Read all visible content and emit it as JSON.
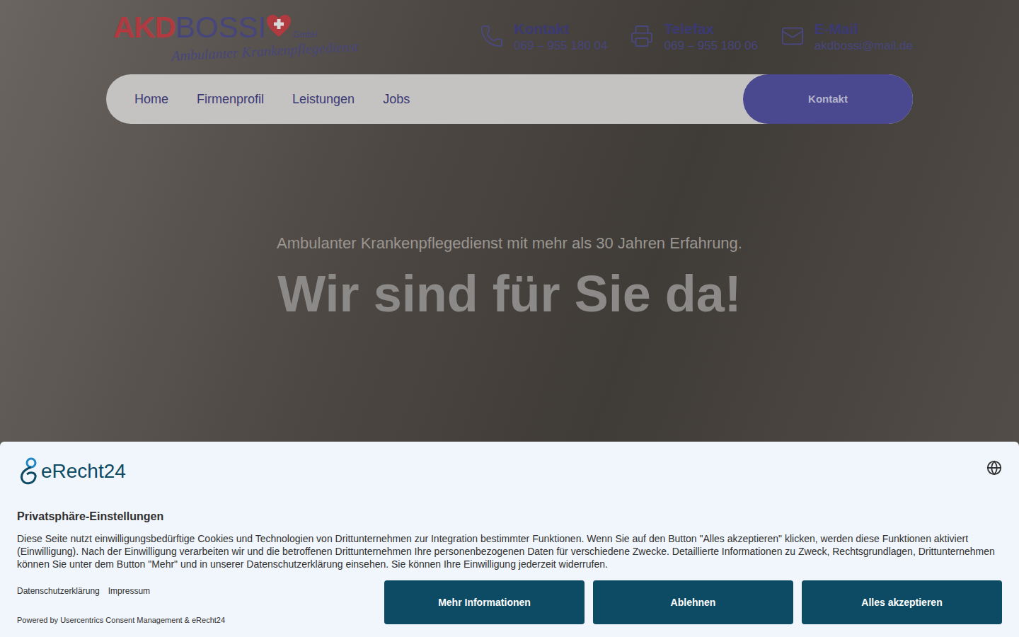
{
  "logo": {
    "brand_bold": "AKD",
    "brand": "BOSSI",
    "suffix": "GmbH",
    "tagline": "Ambulanter Krankenpflegedienst"
  },
  "contacts": [
    {
      "kind": "phone",
      "label": "Kontakt",
      "value": "069 – 955 180 04"
    },
    {
      "kind": "fax",
      "label": "Telefax",
      "value": "069 – 955 180 06"
    },
    {
      "kind": "mail",
      "label": "E-Mail",
      "value": "akdbossi@mail.de"
    }
  ],
  "nav": {
    "items": [
      {
        "label": "Home",
        "selected": false
      },
      {
        "label": "Firmenprofil",
        "selected": false
      },
      {
        "label": "Leistungen",
        "selected": false
      },
      {
        "label": "Jobs",
        "selected": false
      }
    ],
    "button": "Kontakt"
  },
  "hero": {
    "subtitle": "Ambulanter Krankenpflegedienst mit mehr als 30 Jahren Erfahrung.",
    "title": "Wir sind für Sie da!"
  },
  "consent": {
    "provider": "eRecht24",
    "title": "Privatsphäre-Einstellungen",
    "text": "Diese Seite nutzt einwilligungsbedürftige Cookies und Technologien von Drittunternehmen zur Integration bestimmter Funktionen. Wenn Sie auf den Button \"Alles akzeptieren\" klicken, werden diese Funktionen aktiviert (Einwilligung). Nach der Einwilligung verarbeiten wir und die betroffenen Drittunternehmen Ihre personenbezogenen Daten für verschiedene Zwecke. Detaillierte Informationen zu Zweck, Rechtsgrundlagen, Drittunternehmen können Sie unter dem Button \"Mehr\" und in unserer Datenschutzerklärung einsehen. Sie können Ihre Einwilligung jederzeit widerrufen.",
    "links": [
      "Datenschutzerklärung",
      "Impressum"
    ],
    "powered": "Powered by Usercentrics Consent Management & eRecht24",
    "buttons": [
      "Mehr Informationen",
      "Ablehnen",
      "Alles akzeptieren"
    ]
  }
}
